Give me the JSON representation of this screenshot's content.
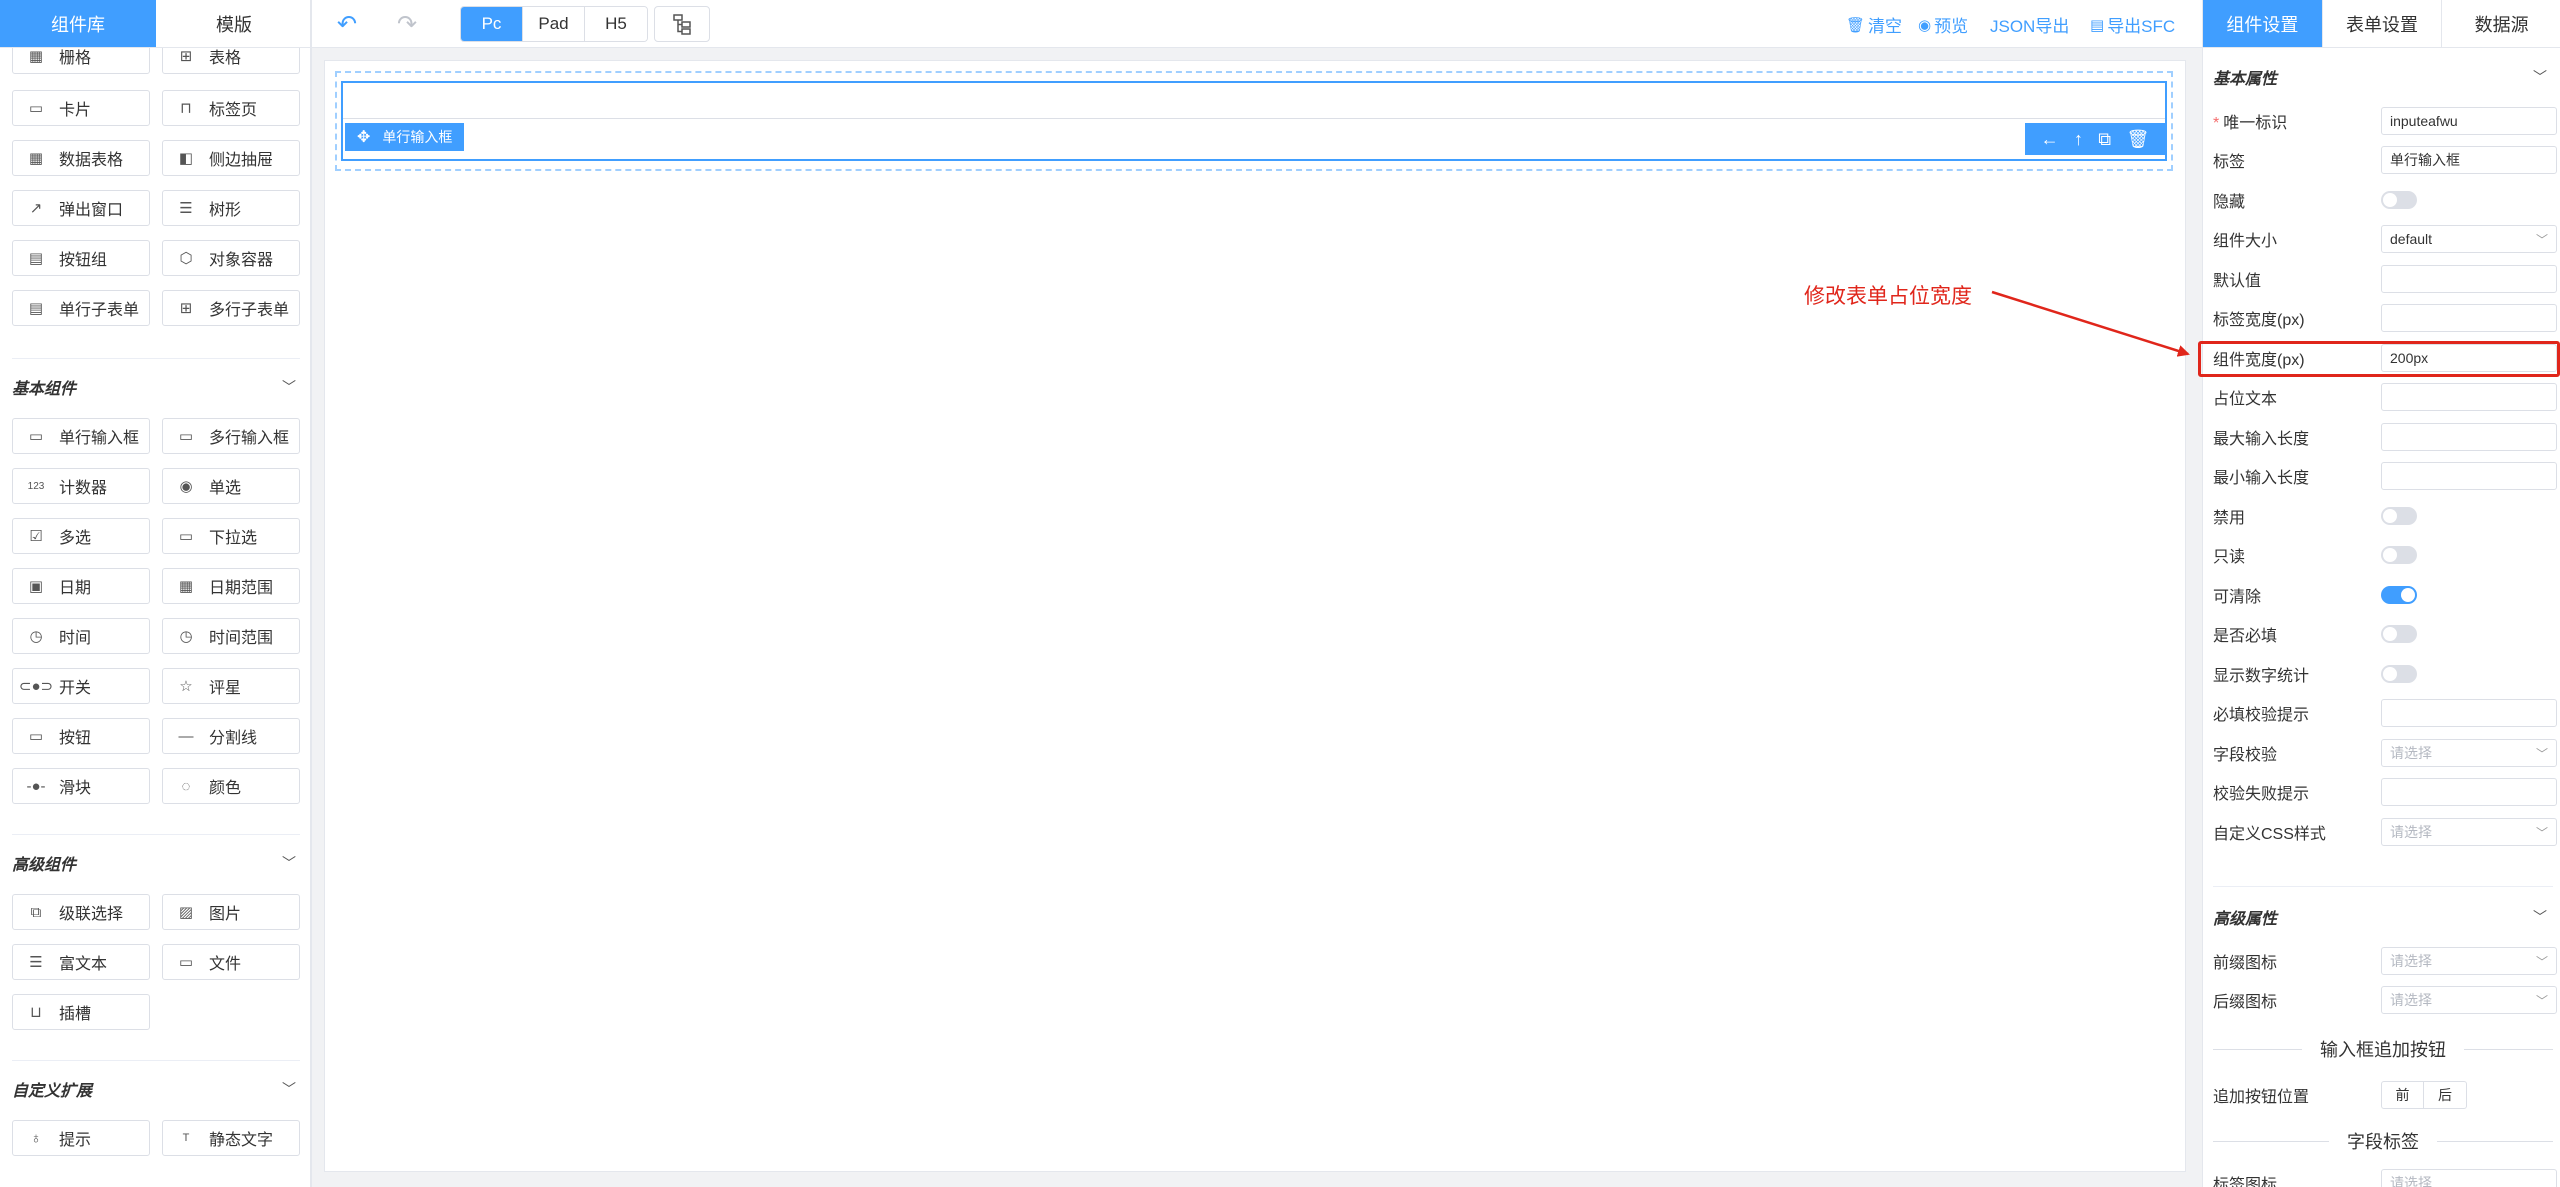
{
  "left_tabs": [
    "组件库",
    "模版"
  ],
  "layout_components": [
    "栅格",
    "表格",
    "卡片",
    "标签页",
    "数据表格",
    "侧边抽屉",
    "弹出窗口",
    "树形",
    "按钮组",
    "对象容器",
    "单行子表单",
    "多行子表单"
  ],
  "basic_group": {
    "title": "基本组件",
    "items": [
      "单行输入框",
      "多行输入框",
      "计数器",
      "单选",
      "多选",
      "下拉选",
      "日期",
      "日期范围",
      "时间",
      "时间范围",
      "开关",
      "评星",
      "按钮",
      "分割线",
      "滑块",
      "颜色"
    ]
  },
  "advanced_group": {
    "title": "高级组件",
    "items": [
      "级联选择",
      "图片",
      "富文本",
      "文件",
      "插槽"
    ]
  },
  "custom_group": {
    "title": "自定义扩展",
    "items": [
      "提示",
      "静态文字"
    ]
  },
  "toolbar": {
    "devices": [
      "Pc",
      "Pad",
      "H5"
    ],
    "clear": "清空",
    "preview": "预览",
    "json_export": "JSON导出",
    "sfc_export": "导出SFC"
  },
  "canvas": {
    "widget_tag": "单行输入框"
  },
  "annotation": {
    "text": "修改表单占位宽度"
  },
  "right_tabs": [
    "组件设置",
    "表单设置",
    "数据源"
  ],
  "basic_props": {
    "title": "基本属性",
    "unique_id_label": "唯一标识",
    "unique_id_value": "inputeafwu",
    "label_label": "标签",
    "label_value": "单行输入框",
    "hidden_label": "隐藏",
    "size_label": "组件大小",
    "size_value": "default",
    "default_label": "默认值",
    "label_width_label": "标签宽度(px)",
    "comp_width_label": "组件宽度(px)",
    "comp_width_value": "200px",
    "placeholder_label": "占位文本",
    "max_len_label": "最大输入长度",
    "min_len_label": "最小输入长度",
    "disabled_label": "禁用",
    "readonly_label": "只读",
    "clearable_label": "可清除",
    "required_label": "是否必填",
    "show_count_label": "显示数字统计",
    "required_msg_label": "必填校验提示",
    "field_validate_label": "字段校验",
    "validate_fail_label": "校验失败提示",
    "css_label": "自定义CSS样式",
    "select_placeholder": "请选择"
  },
  "advanced_props": {
    "title": "高级属性",
    "prefix_icon_label": "前缀图标",
    "suffix_icon_label": "后缀图标",
    "append_btn_divider": "输入框追加按钮",
    "append_pos_label": "追加按钮位置",
    "append_pos_options": [
      "前",
      "后"
    ],
    "field_tag_divider": "字段标签",
    "tag_icon_label": "标签图标"
  },
  "colors": {
    "primary": "#409eff",
    "annotation": "#e0261b"
  }
}
